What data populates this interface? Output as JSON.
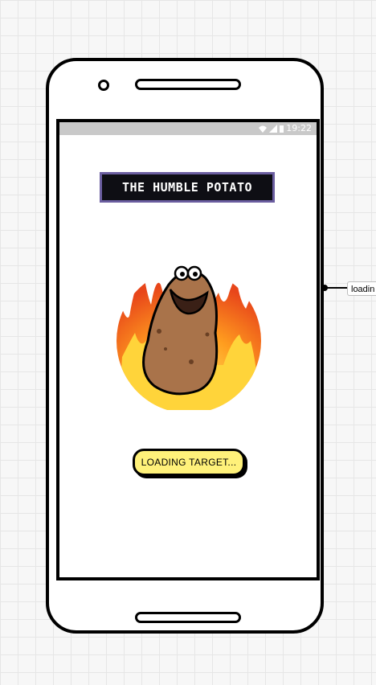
{
  "status_bar": {
    "time": "19:22",
    "icons": [
      "wifi-icon",
      "signal-icon",
      "battery-icon"
    ]
  },
  "app": {
    "title": "THE HUMBLE POTATO",
    "title_bg": "#0e0e14",
    "title_border": "#6b5ea0"
  },
  "hero_image": {
    "subject": "smiling potato with flames"
  },
  "loading_button": {
    "label": "LOADING TARGET...",
    "bg": "#fff17a"
  },
  "annotation": {
    "label": "loadin"
  }
}
